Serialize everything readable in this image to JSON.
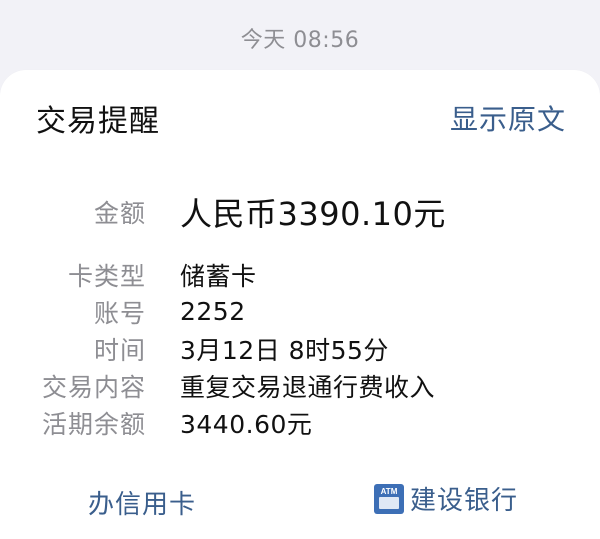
{
  "timestamp": "今天 08:56",
  "card": {
    "title": "交易提醒",
    "view_original_label": "显示原文"
  },
  "amount": {
    "label": "金额",
    "value": "人民币3390.10元"
  },
  "fields": [
    {
      "label": "卡类型",
      "value": "储蓄卡"
    },
    {
      "label": "账号",
      "value": "2252"
    },
    {
      "label": "时间",
      "value": "3月12日 8时55分"
    },
    {
      "label": "交易内容",
      "value": "重复交易退通行费收入"
    },
    {
      "label": "活期余额",
      "value": "3440.60元"
    }
  ],
  "footer": {
    "credit_card_label": "办信用卡",
    "atm_icon_text": "ATM",
    "bank_name": "建设银行"
  },
  "colors": {
    "link": "#3a5e8c",
    "label_gray": "#8e8e93",
    "atm_icon_blue": "#3d6fb6"
  },
  "icons": {
    "bank_icon": "atm-icon"
  }
}
